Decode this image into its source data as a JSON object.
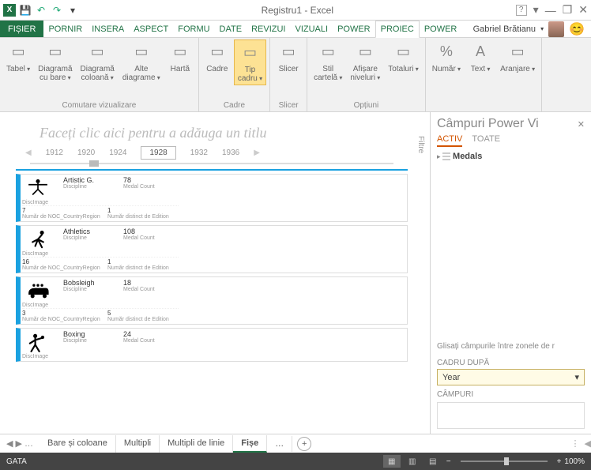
{
  "title": "Registru1 - Excel",
  "qat": {
    "excel": "x",
    "save": "💾",
    "undo": "↶",
    "redo": "↷",
    "custom": "▾"
  },
  "win": {
    "help": "?",
    "opts": "▾",
    "min": "—",
    "max": "❐",
    "close": "✕"
  },
  "tabs": [
    "FIȘIER",
    "PORNIR",
    "INSERA",
    "ASPECT",
    "FORMU",
    "DATE",
    "REVIZUI",
    "VIZUALI",
    "POWER",
    "PROIEC",
    "POWER"
  ],
  "tabs_active_index": 9,
  "user": {
    "name": "Gabriel Brătianu"
  },
  "ribbon": {
    "groups": [
      {
        "label": "Comutare vizualizare",
        "buttons": [
          {
            "name": "tabel",
            "label": "Tabel",
            "drop": true
          },
          {
            "name": "diag-bare",
            "label": "Diagramă\ncu bare",
            "drop": true
          },
          {
            "name": "diag-col",
            "label": "Diagramă\ncoloană",
            "drop": true
          },
          {
            "name": "alte-diag",
            "label": "Alte\ndiagrame",
            "drop": true
          },
          {
            "name": "harta",
            "label": "Hartă"
          }
        ]
      },
      {
        "label": "Cadre",
        "buttons": [
          {
            "name": "cadre",
            "label": "Cadre"
          },
          {
            "name": "tip-cadru",
            "label": "Tip\ncadru",
            "drop": true,
            "selected": true
          }
        ]
      },
      {
        "label": "Slicer",
        "buttons": [
          {
            "name": "slicer",
            "label": "Slicer"
          }
        ]
      },
      {
        "label": "Opțiuni",
        "buttons": [
          {
            "name": "stil-cart",
            "label": "Stil\ncartelă",
            "drop": true
          },
          {
            "name": "afis-niv",
            "label": "Afișare\nniveluri",
            "drop": true
          },
          {
            "name": "totaluri",
            "label": "Totaluri",
            "drop": true
          }
        ]
      },
      {
        "label": "",
        "buttons": [
          {
            "name": "numar",
            "label": "Număr",
            "drop": true,
            "icon": "%"
          },
          {
            "name": "text",
            "label": "Text",
            "drop": true,
            "icon": "A"
          },
          {
            "name": "aranjare",
            "label": "Aranjare",
            "drop": true
          }
        ]
      }
    ]
  },
  "canvas": {
    "title_placeholder": "Faceți clic aici pentru a adăuga un titlu",
    "years": [
      "1912",
      "1920",
      "1924",
      "1928",
      "1932",
      "1936"
    ],
    "selected_year_index": 3,
    "filtre_label": "Filtre",
    "cards": [
      {
        "discipline": "Artistic G.",
        "count": "78",
        "disc_label": "Discipline",
        "cnt_label": "Medal Count",
        "dimg": "DiscImage",
        "noc": "7",
        "noc_label": "Număr de NOC_CountryRegion",
        "ed": "1",
        "ed_label": "Număr distinct de Edition",
        "icon": "gym"
      },
      {
        "discipline": "Athletics",
        "count": "108",
        "disc_label": "Discipline",
        "cnt_label": "Medal Count",
        "dimg": "DiscImage",
        "noc": "16",
        "noc_label": "Număr de NOC_CountryRegion",
        "ed": "1",
        "ed_label": "Număr distinct de Edition",
        "icon": "run"
      },
      {
        "discipline": "Bobsleigh",
        "count": "18",
        "disc_label": "Discipline",
        "cnt_label": "Medal Count",
        "dimg": "DiscImage",
        "noc": "3",
        "noc_label": "Număr de NOC_CountryRegion",
        "ed": "5",
        "ed_label": "Număr distinct de Edition",
        "icon": "bob"
      },
      {
        "discipline": "Boxing",
        "count": "24",
        "disc_label": "Discipline",
        "cnt_label": "Medal Count",
        "dimg": "DiscImage",
        "noc": "",
        "noc_label": "",
        "ed": "",
        "ed_label": "",
        "icon": "box"
      }
    ]
  },
  "pane": {
    "title": "Câmpuri Power Vi",
    "close": "✕",
    "tabs": [
      "ACTIV",
      "TOATE"
    ],
    "tabs_active_index": 0,
    "tree": {
      "item": "Medals"
    },
    "hint": "Glisați câmpurile între zonele de r",
    "cadru_label": "CADRU DUPĂ",
    "cadru_value": "Year",
    "campuri_label": "CÂMPURI"
  },
  "sheets": {
    "nav": "◀ ▶ …",
    "tabs": [
      "Bare și coloane",
      "Multipli",
      "Multipli de linie",
      "Fișe"
    ],
    "active_index": 3,
    "more": "…",
    "add": "+"
  },
  "status": {
    "state": "GATA",
    "zoom": "100%",
    "minus": "−",
    "plus": "+"
  }
}
